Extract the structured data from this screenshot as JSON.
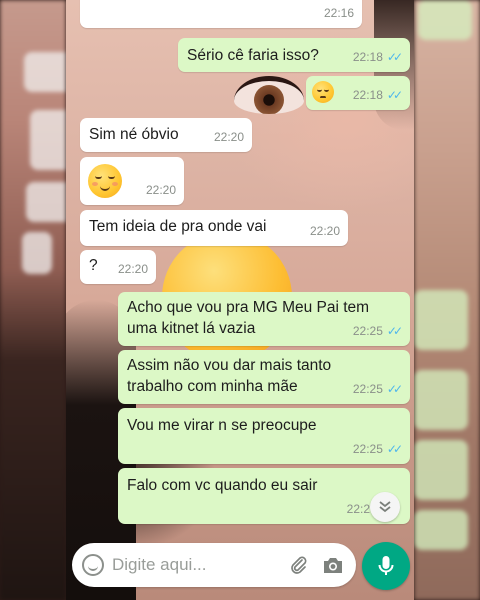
{
  "chat": {
    "messages": [
      {
        "id": "m0",
        "direction": "incoming",
        "text": "",
        "time": "22:16"
      },
      {
        "id": "m1",
        "direction": "outgoing",
        "text": "Sério cê faria isso?",
        "time": "22:18",
        "ticks": "✓✓"
      },
      {
        "id": "m2",
        "direction": "outgoing",
        "text": "🥺",
        "time": "22:18",
        "ticks": "✓✓",
        "emoji": "pleading-face"
      },
      {
        "id": "m3",
        "direction": "incoming",
        "text": "Sim né óbvio",
        "time": "22:20"
      },
      {
        "id": "m4",
        "direction": "incoming",
        "text": "😌",
        "time": "22:20",
        "emoji": "relieved-face"
      },
      {
        "id": "m5",
        "direction": "incoming",
        "text": "Tem ideia de pra onde vai",
        "time": "22:20"
      },
      {
        "id": "m6",
        "direction": "incoming",
        "text": "?",
        "time": "22:20"
      },
      {
        "id": "m7",
        "direction": "outgoing",
        "line1": "Acho que vou pra MG Meu Pai tem",
        "line2": "uma kitnet lá vazia",
        "time": "22:25",
        "ticks": "✓✓"
      },
      {
        "id": "m8",
        "direction": "outgoing",
        "line1": "Assim não vou dar mais tanto",
        "line2": "trabalho com minha mãe",
        "time": "22:25",
        "ticks": "✓✓"
      },
      {
        "id": "m9",
        "direction": "outgoing",
        "text": "Vou me virar n se preocupe",
        "time": "22:25",
        "ticks": "✓✓"
      },
      {
        "id": "m10",
        "direction": "outgoing",
        "text": "Falo com vc quando eu sair",
        "time": "22:2"
      }
    ]
  },
  "composer": {
    "placeholder": "Digite aqui...",
    "emoji_icon": "smiley-icon",
    "attach_icon": "paperclip-icon",
    "camera_icon": "camera-icon",
    "mic_icon": "microphone-icon",
    "scroll_down_icon": "chevron-double-down-icon"
  },
  "colors": {
    "incoming_bubble": "#ffffff",
    "outgoing_bubble": "#dcf8c6",
    "read_ticks": "#4fb6ec",
    "mic_button": "#00a884"
  }
}
